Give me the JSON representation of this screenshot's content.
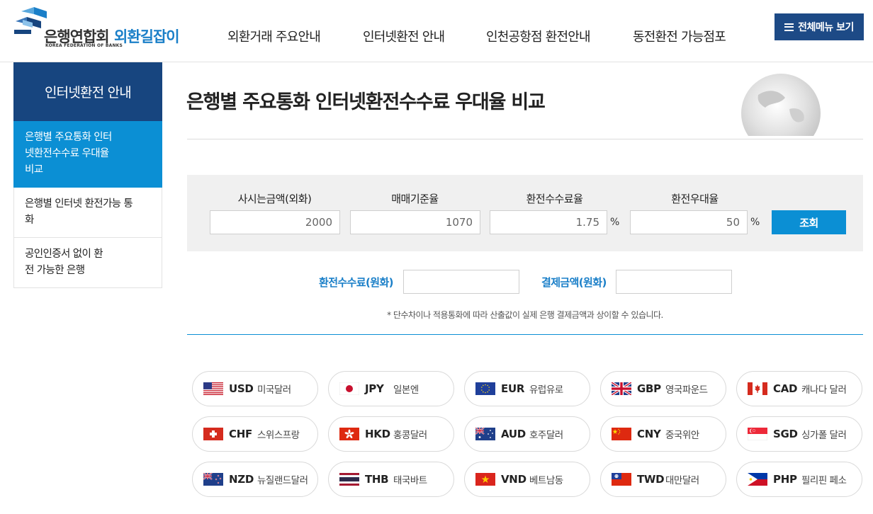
{
  "header": {
    "logo_text": "은행연합회",
    "logo_sub": "KOREA FEDERATION OF BANKS",
    "service_name": "외환길잡이",
    "gnb": [
      "외환거래 주요안내",
      "인터넷환전 안내",
      "인천공항점 환전안내",
      "동전환전 가능점포"
    ],
    "allmenu_label": "전체메뉴 보기"
  },
  "sidebar": {
    "title": "인터넷환전 안내",
    "items": [
      {
        "label": "은행별 주요통화 인터넷환전수수료 우대율 비교",
        "active": true
      },
      {
        "label": "은행별 인터넷 환전가능 통화",
        "active": false
      },
      {
        "label": "공인인증서 없이 환전 가능한 은행",
        "active": false
      }
    ]
  },
  "main": {
    "title": "은행별 주요통화 인터넷환전수수료 우대율 비교",
    "calculator": {
      "labels": {
        "amount": "사시는금액(외화)",
        "base_rate": "매매기준율",
        "fee_rate": "환전수수료율",
        "preferential": "환전우대율"
      },
      "values": {
        "amount": "2000",
        "base_rate": "1070",
        "fee_rate": "1.75",
        "preferential": "50"
      },
      "percent_sign": "%",
      "query_button": "조회"
    },
    "result": {
      "fee_label": "환전수수료(원화)",
      "payment_label": "결제금액(원화)",
      "fee_value": "",
      "payment_value": ""
    },
    "notice": "* 단수차이나 적용통화에 따라 산출값이 실제 은행 결제금액과 상이할 수 있습니다."
  },
  "currencies": [
    {
      "code": "USD",
      "name": "미국달러"
    },
    {
      "code": "JPY",
      "name": "일본엔"
    },
    {
      "code": "EUR",
      "name": "유럽유로"
    },
    {
      "code": "GBP",
      "name": "영국파운드"
    },
    {
      "code": "CAD",
      "name": "캐나다 달러"
    },
    {
      "code": "CHF",
      "name": "스위스프랑"
    },
    {
      "code": "HKD",
      "name": "홍콩달러"
    },
    {
      "code": "AUD",
      "name": "호주달러"
    },
    {
      "code": "CNY",
      "name": "중국위안"
    },
    {
      "code": "SGD",
      "name": "싱가폴 달러"
    },
    {
      "code": "NZD",
      "name": "뉴질랜드달러"
    },
    {
      "code": "THB",
      "name": "태국바트"
    },
    {
      "code": "VND",
      "name": "베트남동"
    },
    {
      "code": "TWD",
      "name": "대만달러"
    },
    {
      "code": "PHP",
      "name": "필리핀 페소"
    }
  ],
  "colors": {
    "brand_navy": "#17457f",
    "accent_blue": "#0b8fd4",
    "link_blue": "#1a7fc8"
  }
}
